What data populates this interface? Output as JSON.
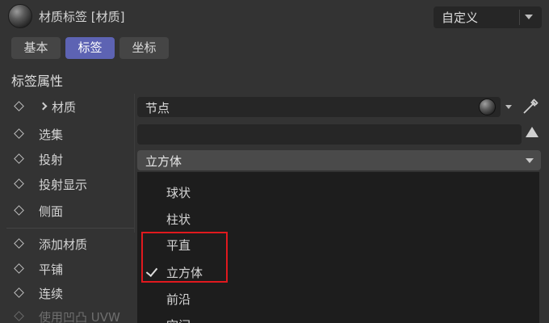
{
  "header": {
    "title": "材质标签 [材质]",
    "preset_value": "自定义",
    "material_icon": "material-sphere-icon"
  },
  "tabs": [
    {
      "label": "基本",
      "active": false
    },
    {
      "label": "标签",
      "active": true
    },
    {
      "label": "坐标",
      "active": false
    }
  ],
  "section": {
    "title": "标签属性"
  },
  "properties": [
    {
      "label": "材质",
      "dim": false
    },
    {
      "label": "选集",
      "dim": false
    },
    {
      "label": "投射",
      "dim": false
    },
    {
      "label": "投射显示",
      "dim": false
    },
    {
      "label": "侧面",
      "dim": false
    },
    {
      "label": "添加材质",
      "dim": false
    },
    {
      "label": "平铺",
      "dim": false
    },
    {
      "label": "连续",
      "dim": false
    },
    {
      "label": "使用凹凸 UVW",
      "dim": true
    }
  ],
  "fields": {
    "material_value": "节点",
    "selection_value": "",
    "projection_value": "立方体"
  },
  "projection_menu": {
    "items": [
      {
        "label": "球状",
        "checked": false
      },
      {
        "label": "柱状",
        "checked": false
      },
      {
        "label": "平直",
        "checked": false
      },
      {
        "label": "立方体",
        "checked": true
      },
      {
        "label": "前沿",
        "checked": false
      },
      {
        "label": "空间",
        "checked": false
      }
    ]
  },
  "colors": {
    "background": "#333333",
    "field": "#262626",
    "active_tab": "#5d63b3",
    "menu": "#1d1d1d",
    "highlight": "#e0191e"
  }
}
